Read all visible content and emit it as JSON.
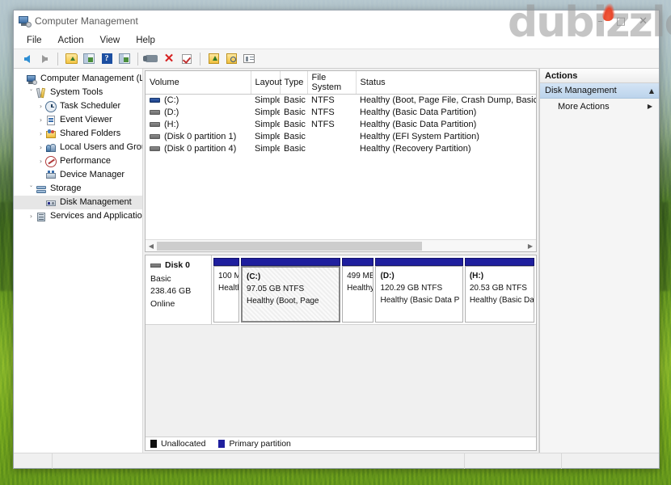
{
  "window": {
    "title": "Computer Management",
    "icon": "computer-management-icon",
    "controls": {
      "minimize": "–",
      "maximize": "□",
      "close": "✕"
    }
  },
  "watermark": {
    "text": "dubizzle"
  },
  "menubar": {
    "items": [
      "File",
      "Action",
      "View",
      "Help"
    ]
  },
  "toolbar": {
    "items": [
      {
        "name": "back-icon",
        "kind": "arrow-l"
      },
      {
        "name": "forward-icon",
        "kind": "arrow-r"
      },
      {
        "name": "up-one-level-icon",
        "kind": "folderup"
      },
      {
        "name": "show-hide-console-tree-icon",
        "kind": "pane"
      },
      {
        "name": "help-icon",
        "kind": "help",
        "glyph": "?"
      },
      {
        "name": "show-hide-action-pane-icon",
        "kind": "pane"
      },
      {
        "name": "properties-icon",
        "kind": "wrench"
      },
      {
        "name": "delete-icon",
        "kind": "x",
        "glyph": "✕"
      },
      {
        "name": "refresh-icon",
        "kind": "check"
      },
      {
        "name": "export-list-icon",
        "kind": "export"
      },
      {
        "name": "rescan-disks-icon",
        "kind": "search"
      },
      {
        "name": "view-list-icon",
        "kind": "list"
      }
    ]
  },
  "tree": {
    "items": [
      {
        "label": "Computer Management (Local)",
        "icon": "computer-icon",
        "depth": 0,
        "twisty": "",
        "selected": false
      },
      {
        "label": "System Tools",
        "icon": "tools-icon",
        "depth": 1,
        "twisty": "ˇ",
        "selected": false
      },
      {
        "label": "Task Scheduler",
        "icon": "clock-icon",
        "depth": 2,
        "twisty": "›",
        "selected": false
      },
      {
        "label": "Event Viewer",
        "icon": "event-icon",
        "depth": 2,
        "twisty": "›",
        "selected": false
      },
      {
        "label": "Shared Folders",
        "icon": "folder-icon",
        "depth": 2,
        "twisty": "›",
        "selected": false
      },
      {
        "label": "Local Users and Groups",
        "icon": "users-icon",
        "depth": 2,
        "twisty": "›",
        "selected": false
      },
      {
        "label": "Performance",
        "icon": "gauge-icon",
        "depth": 2,
        "twisty": "›",
        "selected": false
      },
      {
        "label": "Device Manager",
        "icon": "device-icon",
        "depth": 2,
        "twisty": "",
        "selected": false
      },
      {
        "label": "Storage",
        "icon": "storage-icon",
        "depth": 1,
        "twisty": "ˇ",
        "selected": false
      },
      {
        "label": "Disk Management",
        "icon": "disk-icon",
        "depth": 2,
        "twisty": "",
        "selected": true
      },
      {
        "label": "Services and Applications",
        "icon": "services-icon",
        "depth": 1,
        "twisty": "›",
        "selected": false
      }
    ]
  },
  "volume_list": {
    "columns": [
      "Volume",
      "Layout",
      "Type",
      "File System",
      "Status"
    ],
    "rows": [
      {
        "volume": "(C:)",
        "layout": "Simple",
        "type": "Basic",
        "filesystem": "NTFS",
        "status": "Healthy (Boot, Page File, Crash Dump, Basic Data Partition)",
        "selected": true
      },
      {
        "volume": "(D:)",
        "layout": "Simple",
        "type": "Basic",
        "filesystem": "NTFS",
        "status": "Healthy (Basic Data Partition)",
        "selected": false
      },
      {
        "volume": "(H:)",
        "layout": "Simple",
        "type": "Basic",
        "filesystem": "NTFS",
        "status": "Healthy (Basic Data Partition)",
        "selected": false
      },
      {
        "volume": "(Disk 0 partition 1)",
        "layout": "Simple",
        "type": "Basic",
        "filesystem": "",
        "status": "Healthy (EFI System Partition)",
        "selected": false
      },
      {
        "volume": "(Disk 0 partition 4)",
        "layout": "Simple",
        "type": "Basic",
        "filesystem": "",
        "status": "Healthy (Recovery Partition)",
        "selected": false
      }
    ]
  },
  "disk_view": {
    "disk": {
      "name": "Disk 0",
      "type": "Basic",
      "size": "238.46 GB",
      "state": "Online"
    },
    "partitions": [
      {
        "label": "",
        "size": "100 M",
        "status": "Health",
        "flex": 26,
        "selected": false
      },
      {
        "label": "(C:)",
        "size": "97.05 GB NTFS",
        "status": "Healthy (Boot, Page ",
        "flex": 100,
        "selected": true
      },
      {
        "label": "",
        "size": "499 MB",
        "status": "Healthy (F",
        "flex": 32,
        "selected": false
      },
      {
        "label": "(D:)",
        "size": "120.29 GB NTFS",
        "status": "Healthy (Basic Data P",
        "flex": 88,
        "selected": false
      },
      {
        "label": "(H:)",
        "size": "20.53 GB NTFS",
        "status": "Healthy (Basic Da",
        "flex": 70,
        "selected": false
      }
    ]
  },
  "legend": {
    "items": [
      {
        "label": "Unallocated",
        "color": "#111111"
      },
      {
        "label": "Primary partition",
        "color": "#1f1f9e"
      }
    ]
  },
  "actions": {
    "header": "Actions",
    "group": {
      "label": "Disk Management",
      "caret": "▲"
    },
    "items": [
      {
        "label": "More Actions",
        "caret": "▶"
      }
    ]
  },
  "colors": {
    "accent_selection": "#bcd4ec",
    "primary_partition": "#1f1f9e",
    "unallocated": "#111111",
    "window_bg": "#f0f0f0"
  }
}
